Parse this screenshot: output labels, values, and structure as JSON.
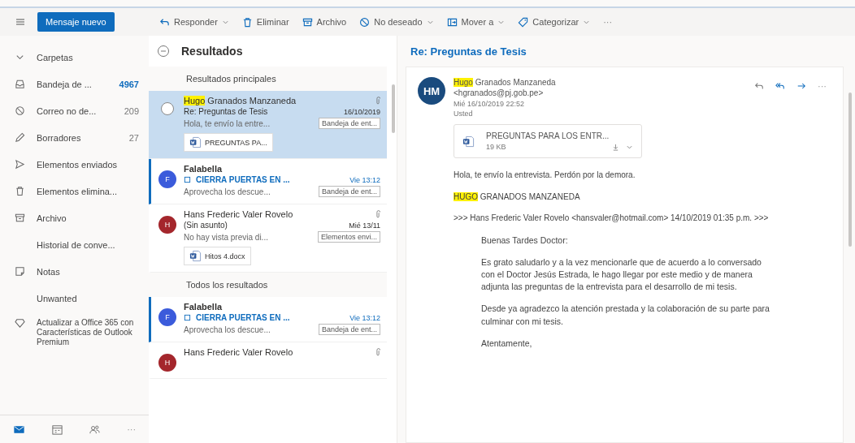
{
  "toolbar": {
    "new_message": "Mensaje nuevo",
    "actions": [
      {
        "kind": "reply",
        "label": "Responder",
        "dropdown": true
      },
      {
        "kind": "delete",
        "label": "Eliminar",
        "dropdown": false
      },
      {
        "kind": "archive",
        "label": "Archivo",
        "dropdown": false
      },
      {
        "kind": "junk",
        "label": "No deseado",
        "dropdown": true
      },
      {
        "kind": "move",
        "label": "Mover a",
        "dropdown": true
      },
      {
        "kind": "tag",
        "label": "Categorizar",
        "dropdown": true
      }
    ],
    "more": "···"
  },
  "sidebar": {
    "folders_header": {
      "label": "Carpetas",
      "expanded": true
    },
    "items": [
      {
        "kind": "inbox",
        "label": "Bandeja de ...",
        "count": "4967",
        "count_unread": true
      },
      {
        "kind": "junk",
        "label": "Correo no de...",
        "count": "209",
        "count_unread": false
      },
      {
        "kind": "drafts",
        "label": "Borradores",
        "count": "27",
        "count_unread": false
      },
      {
        "kind": "sent",
        "label": "Elementos enviados"
      },
      {
        "kind": "deleted",
        "label": "Elementos elimina..."
      },
      {
        "kind": "archive",
        "label": "Archivo"
      },
      {
        "kind": "none",
        "label": "Historial de conve..."
      },
      {
        "kind": "notes",
        "label": "Notas"
      },
      {
        "kind": "none",
        "label": "Unwanted"
      }
    ],
    "upgrade": "Actualizar a Office 365 con Características de Outlook Premium",
    "apps": [
      {
        "kind": "mail",
        "selected": true
      },
      {
        "kind": "calendar",
        "selected": false
      },
      {
        "kind": "people",
        "selected": false
      }
    ],
    "apps_more": "···"
  },
  "message_list": {
    "title": "Resultados",
    "sections": [
      {
        "title": "Resultados principales",
        "messages": [
          {
            "sender": {
              "highlight": "Hugo",
              "text": " Granados Manzaneda"
            },
            "subject": "Re: Preguntas de Tesis",
            "date": "16/10/2019",
            "preview": "Hola, te envío la entre...",
            "folder": "Bandeja de ent...",
            "attachment": "PREGUNTAS PA...",
            "has_clip": true,
            "selected": true,
            "unread": false
          },
          {
            "sender": {
              "text": "Falabella"
            },
            "avatar": "F",
            "color": "#3b5bdb",
            "subject": "CIERRA PUERTAS EN ...",
            "date": "Vie 13:12",
            "preview": "Aprovecha los descue...",
            "folder": "Bandeja de ent...",
            "has_clip": false,
            "selected": false,
            "unread": true
          },
          {
            "sender": {
              "text": "Hans Frederic Valer Rovelo"
            },
            "avatar": "H",
            "color": "#a4262c",
            "subject": "(Sin asunto)",
            "date": "Mié 13/11",
            "preview": "No hay vista previa di...",
            "folder": "Elementos envi...",
            "attachment": "Hitos 4.docx",
            "has_clip": true,
            "selected": false,
            "unread": false
          }
        ]
      },
      {
        "title": "Todos los resultados",
        "messages": [
          {
            "sender": {
              "text": "Falabella"
            },
            "avatar": "F",
            "color": "#3b5bdb",
            "subject": "CIERRA PUERTAS EN ...",
            "date": "Vie 13:12",
            "preview": "Aprovecha los descue...",
            "folder": "Bandeja de ent...",
            "has_clip": false,
            "selected": false,
            "unread": true
          },
          {
            "sender": {
              "text": "Hans Frederic Valer Rovelo"
            },
            "avatar": "H",
            "color": "#a4262c",
            "has_clip": true,
            "selected": false,
            "unread": false
          }
        ]
      }
    ]
  },
  "reading_pane": {
    "subject": "Re: Preguntas de Tesis",
    "message": {
      "avatar": "HM",
      "from": {
        "highlight": "Hugo",
        "text": " Granados Manzaneda <hgranados@pj.gob.pe>"
      },
      "date": "Mié 16/10/2019 22:52",
      "to": "Usted",
      "more": "···",
      "attachment": {
        "name": "PREGUNTAS PARA LOS ENTR...",
        "size": "19 KB"
      },
      "body": [
        {
          "kind": "text",
          "text": "Hola, te envío la entrevista. Perdón por la demora."
        },
        {
          "kind": "text",
          "highlight": "HUGO",
          "text": " GRANADOS MANZANEDA"
        },
        {
          "kind": "text",
          "text": ">>> Hans Frederic Valer Rovelo <hansvaler@hotmail.com> 14/10/2019 01:35 p.m. >>>"
        },
        {
          "kind": "quote",
          "text": "Buenas Tardes Doctor:"
        },
        {
          "kind": "quote",
          "text": "Es grato saludarlo y a la vez mencionarle que de acuerdo a lo conversado con el Doctor Jesús Estrada, le hago llegar por este medio y  de manera adjunta las preguntas  de la entrevista para el desarrollo de mi tesis."
        },
        {
          "kind": "quote",
          "text": "Desde ya agradezco la atención prestada y la colaboración de su parte para culminar con mi tesis."
        },
        {
          "kind": "quote",
          "text": "Atentamente,"
        }
      ]
    }
  }
}
